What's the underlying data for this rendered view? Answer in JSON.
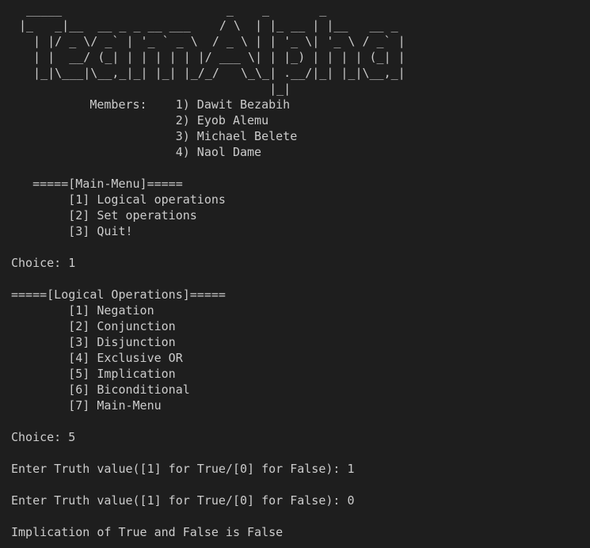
{
  "banner": [
    " _____                       _    _       _           ",
    "|_   _|__  __ _ _ __ ___    / \\  | |_ __ | |__   __ _ ",
    "  | |/ _ \\/ _` | '_ ` _ \\  / _ \\ | | '_ \\| '_ \\ / _` |",
    "  | |  __/ (_| | | | | | |/ ___ \\| | |_) | | | | (_| |",
    "  |_|\\___|\\__,_|_| |_| |_/_/   \\_\\_| .__/|_| |_|\\__,_|",
    "                                   |_|                "
  ],
  "lines": [
    "           Members:    1) Dawit Bezabih",
    "                       2) Eyob Alemu",
    "                       3) Michael Belete",
    "                       4) Naol Dame",
    "",
    "   =====[Main-Menu]=====",
    "        [1] Logical operations",
    "        [2] Set operations",
    "        [3] Quit!",
    "",
    "Choice: 1",
    "",
    "=====[Logical Operations]=====",
    "        [1] Negation",
    "        [2] Conjunction",
    "        [3] Disjunction",
    "        [4] Exclusive OR",
    "        [5] Implication",
    "        [6] Biconditional",
    "        [7] Main-Menu",
    "",
    "Choice: 5",
    "",
    "Enter Truth value([1] for True/[0] for False): 1",
    "",
    "Enter Truth value([1] for True/[0] for False): 0",
    "",
    "Implication of True and False is False"
  ]
}
